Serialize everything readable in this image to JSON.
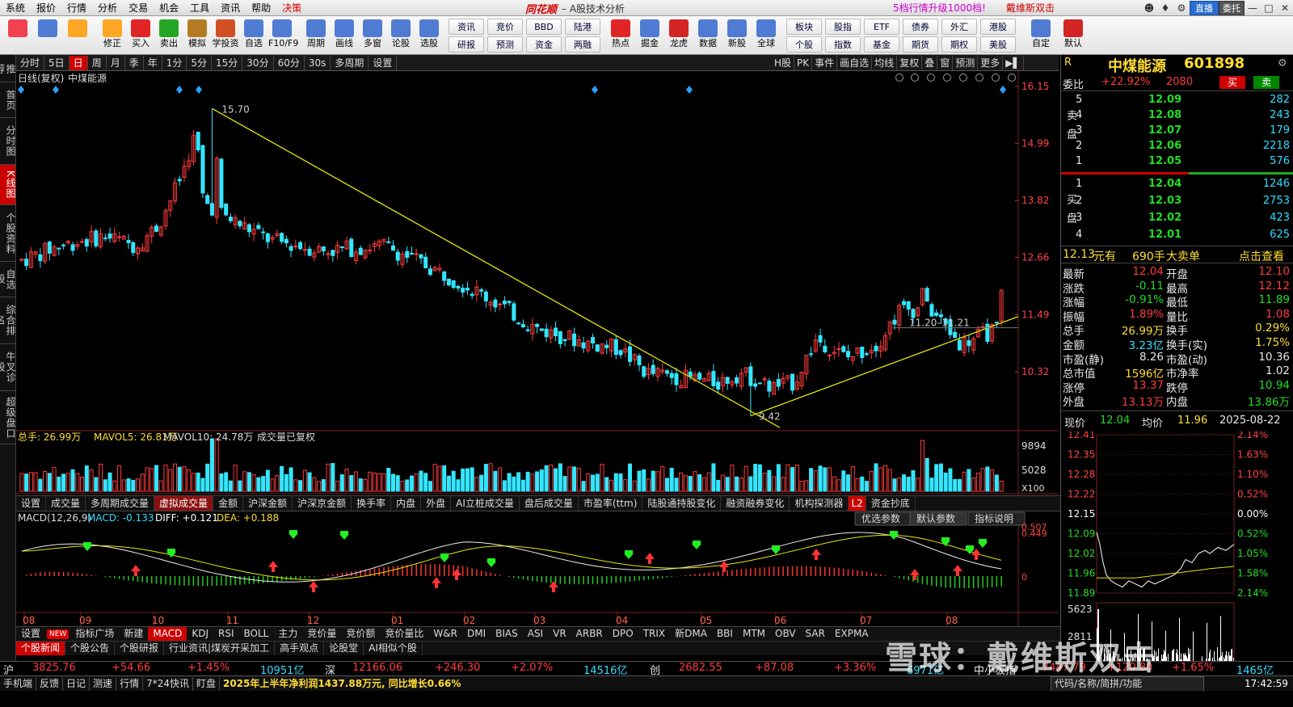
{
  "menu": [
    "系统",
    "报价",
    "行情",
    "分析",
    "交易",
    "机会",
    "工具",
    "资讯",
    "帮助",
    "决策"
  ],
  "brand": {
    "logo": "同花顺",
    "subtitle": "– A股技术分析"
  },
  "promo": {
    "text1": "5档行情升级1000档!",
    "text2": "戴维斯双击"
  },
  "window": {
    "user_btn": "直播",
    "user_btn2": "委托"
  },
  "toolbar": [
    {
      "label": "",
      "icon": "grid-icon",
      "color": "#e23"
    },
    {
      "label": "",
      "icon": "assistant-icon",
      "color": "#36c"
    },
    {
      "label": "",
      "icon": "back-icon",
      "color": "#f90"
    },
    {
      "label": "修正",
      "icon": "arrow-updown-icon",
      "color": "#f90"
    },
    {
      "label": "买入",
      "icon": "buy-icon",
      "color": "#d00"
    },
    {
      "label": "卖出",
      "icon": "sell-icon",
      "color": "#090"
    },
    {
      "label": "模拟",
      "icon": "hammer-icon",
      "color": "#a60"
    },
    {
      "label": "学投资",
      "icon": "book-icon",
      "color": "#c30"
    },
    {
      "label": "自选",
      "icon": "star-icon",
      "color": "#36c"
    },
    {
      "label": "F10/F9",
      "icon": "f10-icon",
      "color": "#36c"
    },
    {
      "label": "周期",
      "icon": "clock-icon",
      "color": "#36c"
    },
    {
      "label": "画线",
      "icon": "pen-icon",
      "color": "#36c"
    },
    {
      "label": "多窗",
      "icon": "windows-icon",
      "color": "#36c"
    },
    {
      "label": "论股",
      "icon": "lun-icon",
      "color": "#36c"
    },
    {
      "label": "选股",
      "icon": "magnify-icon",
      "color": "#36c"
    }
  ],
  "toolbar_small": [
    [
      "资讯",
      "研报"
    ],
    [
      "竞价",
      "预测"
    ],
    [
      "BBD",
      "资金"
    ],
    [
      "陆港",
      "两融"
    ]
  ],
  "toolbar2": [
    {
      "label": "热点",
      "icon": "hot-icon",
      "color": "#d00"
    },
    {
      "label": "掘金",
      "icon": "gold-icon",
      "color": "#36c"
    },
    {
      "label": "龙虎",
      "icon": "dragon-icon",
      "color": "#c00"
    },
    {
      "label": "数据",
      "icon": "pe-icon",
      "color": "#36c"
    },
    {
      "label": "新股",
      "icon": "ipo-icon",
      "color": "#36c"
    },
    {
      "label": "全球",
      "icon": "globe-icon",
      "color": "#36c"
    }
  ],
  "toolbar_small2": [
    [
      "板块",
      "个股"
    ],
    [
      "股指",
      "指数"
    ],
    [
      "ETF",
      "基金"
    ],
    [
      "债券",
      "期货"
    ],
    [
      "外汇",
      "期权"
    ],
    [
      "港股",
      "美股"
    ]
  ],
  "toolbar3": [
    {
      "label": "自定",
      "icon": "custom-icon",
      "color": "#36c"
    },
    {
      "label": "默认",
      "icon": "home-icon",
      "color": "#c00"
    }
  ],
  "leftnav": [
    "推荐",
    "首页",
    "分时图",
    "K线图",
    "个股资料",
    "自选股",
    "综合排名",
    "牛叉诊股",
    "超级盘口"
  ],
  "periods": [
    "分时",
    "5日",
    "日",
    "周",
    "月",
    "季",
    "年",
    "1分",
    "5分",
    "15分",
    "30分",
    "60分",
    "30s",
    "多周期",
    "设置"
  ],
  "period_active": "日",
  "right_tools": [
    "H股",
    "PK",
    "事件",
    "画自选",
    "均线",
    "复权",
    "叠",
    "窗",
    "预测",
    "更多"
  ],
  "kline": {
    "title": "日线(复权)",
    "name": "中煤能源",
    "high_label": "15.70",
    "low_label": "9.42",
    "range_label": "11.20–11.21",
    "y_axis": [
      "16.15",
      "14.99",
      "13.82",
      "12.66",
      "11.49",
      "10.32"
    ]
  },
  "volume": {
    "label_main": "总手: 26.99万",
    "label_ma5": "MAVOL5: 26.81万",
    "label_ma10": "MAVOL10: 24.78万",
    "label_note": "成交量已复权",
    "y_axis": [
      "9894",
      "5028"
    ],
    "unit": "X100"
  },
  "indicators": [
    "设置",
    "成交量",
    "多周期成交量",
    "虚拟成交量",
    "金额",
    "沪深金额",
    "沪深京金额",
    "换手率",
    "内盘",
    "外盘",
    "AI立桩成交量",
    "盘后成交量",
    "市盈率(ttm)",
    "陆股通持股变化",
    "融资融券变化",
    "机构探测器",
    "L2",
    "资金抄底"
  ],
  "indicator_active": "虚拟成交量",
  "macd": {
    "label": "MACD(12,26,9)",
    "macd": "MACD: -0.133",
    "diff": "DIFF: +0.121",
    "dea": "DEA: +0.188",
    "buttons": [
      "优选参数",
      "默认参数",
      "指标说明"
    ],
    "y_axis": [
      "0.507",
      "0.449",
      "0"
    ]
  },
  "months": [
    "08",
    "09",
    "10",
    "11",
    "12",
    "01",
    "02",
    "03",
    "04",
    "05",
    "06",
    "07",
    "08"
  ],
  "indicators2": [
    "设置",
    "NEW",
    "指标广场",
    "新建",
    "MACD",
    "KDJ",
    "RSI",
    "BOLL",
    "主力",
    "竞价量",
    "竞价额",
    "竞价量比",
    "W&R",
    "DMI",
    "BIAS",
    "ASI",
    "VR",
    "ARBR",
    "DPO",
    "TRIX",
    "新DMA",
    "BBI",
    "MTM",
    "OBV",
    "SAR",
    "EXPMA"
  ],
  "news": [
    "个股新闻",
    "个股公告",
    "个股研报",
    "行业资讯|煤炭开采加工",
    "高手观点",
    "论股堂",
    "AI相似个股"
  ],
  "index": {
    "sh": {
      "name": "沪",
      "val": "3825.76",
      "chg": "+54.66",
      "pct": "+1.45%",
      "amt": "10951亿"
    },
    "sz": {
      "name": "深",
      "val": "12166.06",
      "chg": "+246.30",
      "pct": "+2.07%",
      "amt": "14516亿"
    },
    "cy": {
      "name": "创",
      "val": "2682.55",
      "chg": "+87.08",
      "pct": "+3.36%",
      "amt": "6971亿"
    },
    "zx": {
      "name": "中小板指",
      "val": "7447.79",
      "chg": "+120.80",
      "pct": "+1.65%",
      "amt": "1465亿"
    }
  },
  "status": {
    "items": [
      "手机端",
      "反馈",
      "日记",
      "测速",
      "行情",
      "7*24快讯",
      "盯盘"
    ],
    "ticker": "2025年上半年净利润1437.88万元, 同比增长0.66%",
    "search": "代码/名称/简拼/功能",
    "time": "17:42:59"
  },
  "stock": {
    "name": "中煤能源",
    "code": "601898",
    "r": "R"
  },
  "weibi": {
    "label": "委比",
    "val": "+22.92%",
    "vol": "2080",
    "buy": "买",
    "sell": "卖"
  },
  "sell": [
    {
      "n": "5",
      "p": "12.09",
      "v": "282"
    },
    {
      "n": "4",
      "p": "12.08",
      "v": "243"
    },
    {
      "n": "3",
      "p": "12.07",
      "v": "179"
    },
    {
      "n": "2",
      "p": "12.06",
      "v": "2218"
    },
    {
      "n": "1",
      "p": "12.05",
      "v": "576"
    }
  ],
  "buy": [
    {
      "n": "1",
      "p": "12.04",
      "v": "1246"
    },
    {
      "n": "2",
      "p": "12.03",
      "v": "2753"
    },
    {
      "n": "3",
      "p": "12.02",
      "v": "423"
    },
    {
      "n": "4",
      "p": "12.01",
      "v": "625"
    }
  ],
  "sell_label": "卖盘",
  "buy_label": "买盘",
  "big_order": {
    "price": "12.13",
    "yuan": "元有",
    "vol": "690手",
    "txt": "大卖单",
    "link": "点击查看"
  },
  "quote": [
    {
      "l1": "最新",
      "v1": "12.04",
      "c1": "red",
      "l2": "开盘",
      "v2": "12.10",
      "c2": "red"
    },
    {
      "l1": "涨跌",
      "v1": "-0.11",
      "c1": "grn",
      "l2": "最高",
      "v2": "12.12",
      "c2": "red"
    },
    {
      "l1": "涨幅",
      "v1": "-0.91%",
      "c1": "grn",
      "l2": "最低",
      "v2": "11.89",
      "c2": "grn"
    },
    {
      "l1": "振幅",
      "v1": "1.89%",
      "c1": "red",
      "l2": "量比",
      "v2": "1.08",
      "c2": "red"
    },
    {
      "l1": "总手",
      "v1": "26.99万",
      "c1": "yel",
      "l2": "换手",
      "v2": "0.29%",
      "c2": "yel"
    },
    {
      "l1": "金额",
      "v1": "3.23亿",
      "c1": "cyn",
      "l2": "换手(实)",
      "v2": "1.75%",
      "c2": "yel"
    },
    {
      "l1": "市盈(静)",
      "v1": "8.26",
      "c1": "wht",
      "l2": "市盈(动)",
      "v2": "10.36",
      "c2": "wht"
    },
    {
      "l1": "总市值",
      "v1": "1596亿",
      "c1": "yel",
      "l2": "市净率",
      "v2": "1.02",
      "c2": "wht"
    },
    {
      "l1": "涨停",
      "v1": "13.37",
      "c1": "red",
      "l2": "跌停",
      "v2": "10.94",
      "c2": "grn"
    },
    {
      "l1": "外盘",
      "v1": "13.13万",
      "c1": "red",
      "l2": "内盘",
      "v2": "13.86万",
      "c2": "grn"
    }
  ],
  "intraday": {
    "now_label": "现价",
    "now": "12.04",
    "avg_label": "均价",
    "avg": "11.96",
    "date": "2025-08-22",
    "y_left": [
      "12.41",
      "12.35",
      "12.28",
      "12.22",
      "12.15",
      "12.09",
      "12.02",
      "11.96",
      "11.89"
    ],
    "y_right": [
      "2.14%",
      "1.63%",
      "1.10%",
      "0.52%",
      "0.00%",
      "0.52%",
      "1.05%",
      "1.58%",
      "2.14%"
    ],
    "vol_axis": [
      "5623",
      "2811"
    ]
  },
  "watermark": "雪球：戴维斯双击",
  "colors": {
    "up": "#ff3b3b",
    "down": "#33e6ff",
    "trend": "#e6e600",
    "bg": "#000000"
  }
}
